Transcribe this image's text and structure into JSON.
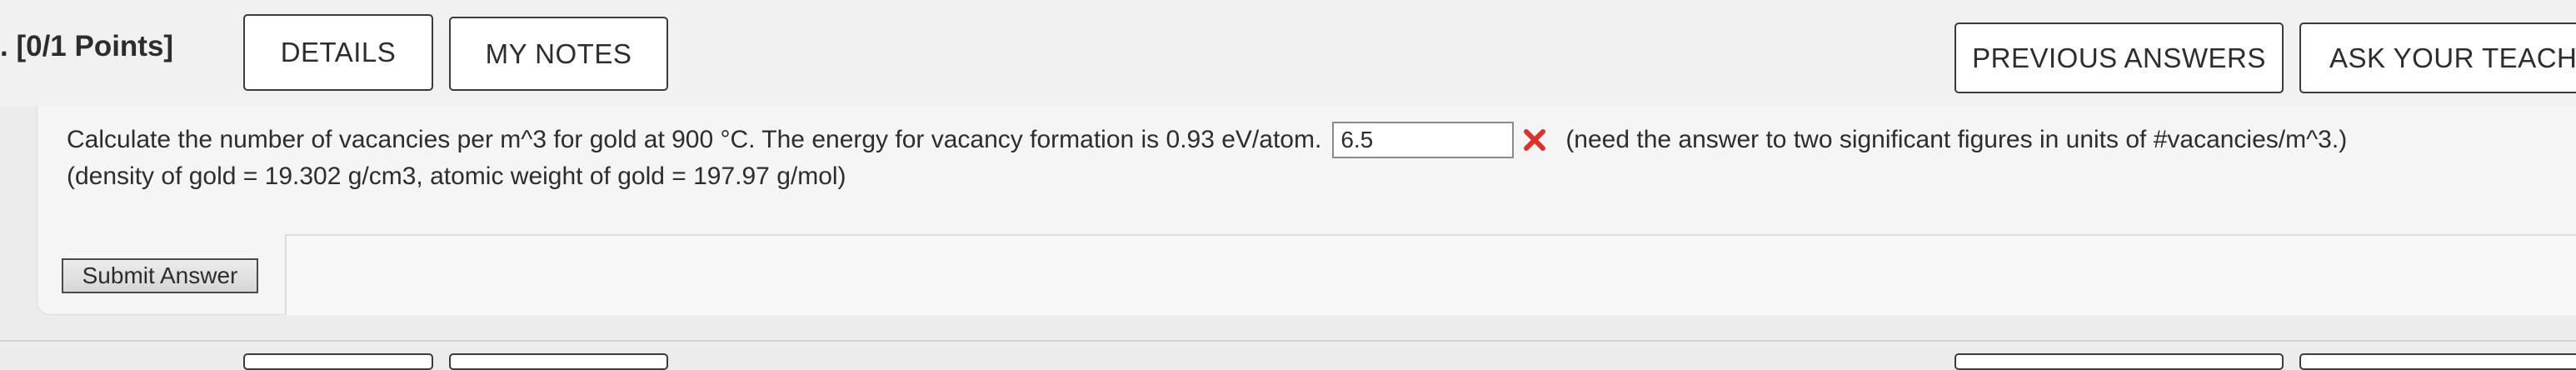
{
  "header": {
    "points_label": ". [0/1 Points]",
    "details_label": "DETAILS",
    "notes_label": "MY NOTES",
    "previous_answers_label": "PREVIOUS ANSWERS",
    "ask_teacher_label": "ASK YOUR TEACHER"
  },
  "question": {
    "text_line1": "Calculate the number of vacancies per m^3 for gold at 900 °C. The energy for vacancy formation is 0.93 eV/atom.",
    "answer_value": "6.5",
    "answer_status": "incorrect",
    "answer_status_icon": "red-x-icon",
    "hint": "(need the answer to two significant figures in units of #vacancies/m^3.)",
    "text_line2": "(density of gold = 19.302 g/cm3, atomic weight of gold = 197.97 g/mol)"
  },
  "submit": {
    "label": "Submit Answer"
  },
  "colors": {
    "incorrect": "#d9342b",
    "background": "#ececec",
    "panel": "#f5f5f5",
    "button_border": "#3b3b3b"
  }
}
